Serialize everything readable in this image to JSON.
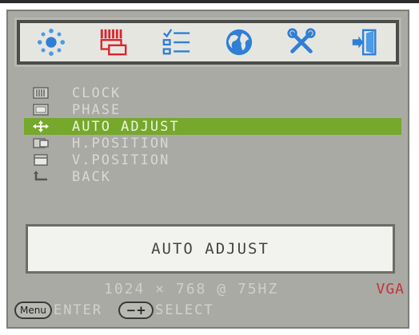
{
  "tabs": [
    {
      "icon": "brightness-sun-icon"
    },
    {
      "icon": "image-adjust-icon",
      "active": true
    },
    {
      "icon": "checklist-icon"
    },
    {
      "icon": "globe-language-icon"
    },
    {
      "icon": "tools-icon"
    },
    {
      "icon": "exit-door-icon"
    }
  ],
  "menu": {
    "items": [
      {
        "label": "CLOCK",
        "icon": "clock-bars-icon"
      },
      {
        "label": "PHASE",
        "icon": "phase-icon"
      },
      {
        "label": "AUTO ADJUST",
        "icon": "auto-adjust-arrows-icon",
        "selected": true
      },
      {
        "label": "H.POSITION",
        "icon": "h-position-icon"
      },
      {
        "label": "V.POSITION",
        "icon": "v-position-icon"
      },
      {
        "label": "BACK",
        "icon": "back-arrow-icon"
      }
    ]
  },
  "description": {
    "text": "AUTO ADJUST"
  },
  "status": {
    "resolution": "1024 × 768 @ 75HZ",
    "signal": "VGA"
  },
  "help": {
    "menu_key": "Menu",
    "enter_label": "ENTER",
    "select_key": "−+",
    "select_label": "SELECT"
  },
  "colors": {
    "highlight": "#76a82b",
    "signal": "#c9313a",
    "panel": "#a9aaa4"
  }
}
